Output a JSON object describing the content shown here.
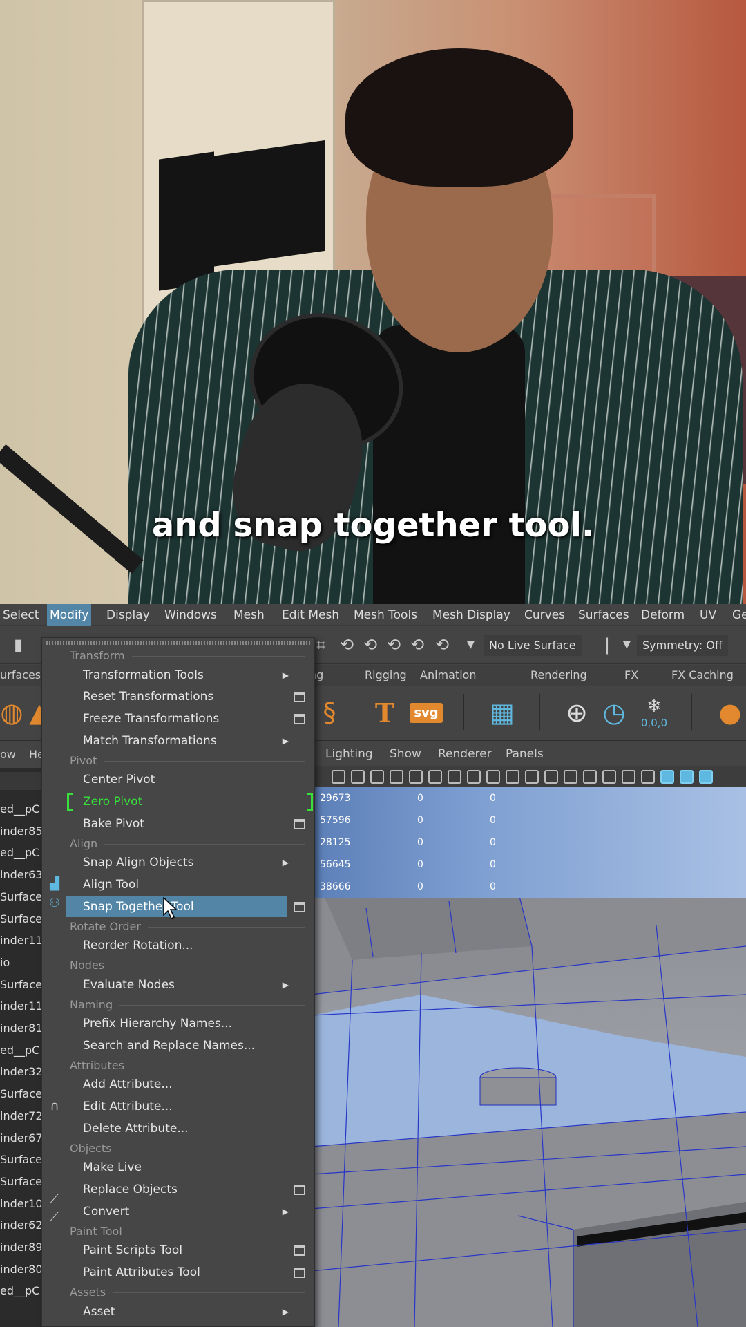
{
  "caption": "and snap together tool.",
  "menubar": [
    "Select",
    "Modify",
    "Display",
    "Windows",
    "Mesh",
    "Edit Mesh",
    "Mesh Tools",
    "Mesh Display",
    "Curves",
    "Surfaces",
    "Deform",
    "UV",
    "Ge"
  ],
  "menubar_active": "Modify",
  "statusline": {
    "live_surface": "No Live Surface",
    "symmetry": "Symmetry: Off"
  },
  "shelf_tabs": [
    "urfaces",
    "ng",
    "Rigging",
    "Animation",
    "Rendering",
    "FX",
    "FX Caching"
  ],
  "shelf_svg_label": "svg",
  "shelf_snap_label": "0,0,0",
  "outliner": {
    "header": [
      "ow",
      "He"
    ],
    "items": [
      "ed__pC",
      "inder85",
      "ed__pC",
      "inder63",
      "Surface",
      "Surface",
      "inder11",
      "io",
      "Surface",
      "inder11",
      "inder81",
      "ed__pC",
      "inder32",
      "Surface",
      "inder72",
      "inder67",
      "Surface",
      "Surface",
      "inder10",
      "inder62",
      "inder89",
      "inder80",
      "ed__pC"
    ]
  },
  "viewport": {
    "menu": [
      "Lighting",
      "Show",
      "Renderer",
      "Panels"
    ],
    "hud_rows": [
      [
        "29673",
        "0",
        "0"
      ],
      [
        "57596",
        "0",
        "0"
      ],
      [
        "28125",
        "0",
        "0"
      ],
      [
        "56645",
        "0",
        "0"
      ],
      [
        "38666",
        "0",
        "0"
      ]
    ]
  },
  "menu": {
    "sections": [
      {
        "label": "Transform",
        "items": [
          {
            "label": "Transformation Tools",
            "submenu": true
          },
          {
            "label": "Reset Transformations",
            "box": true
          },
          {
            "label": "Freeze Transformations",
            "box": true
          },
          {
            "label": "Match Transformations",
            "submenu": true
          }
        ]
      },
      {
        "label": "Pivot",
        "items": [
          {
            "label": "Center Pivot"
          },
          {
            "label": "Zero Pivot",
            "highlighted_green": true
          },
          {
            "label": "Bake Pivot",
            "box": true
          }
        ]
      },
      {
        "label": "Align",
        "items": [
          {
            "label": "Snap Align Objects",
            "submenu": true
          },
          {
            "label": "Align Tool"
          },
          {
            "label": "Snap Together Tool",
            "box": true,
            "hovered": true
          }
        ]
      },
      {
        "label": "Rotate Order",
        "items": [
          {
            "label": "Reorder Rotation..."
          }
        ]
      },
      {
        "label": "Nodes",
        "items": [
          {
            "label": "Evaluate Nodes",
            "submenu": true
          }
        ]
      },
      {
        "label": "Naming",
        "items": [
          {
            "label": "Prefix Hierarchy Names..."
          },
          {
            "label": "Search and Replace Names..."
          }
        ]
      },
      {
        "label": "Attributes",
        "items": [
          {
            "label": "Add Attribute..."
          },
          {
            "label": "Edit Attribute..."
          },
          {
            "label": "Delete Attribute..."
          }
        ]
      },
      {
        "label": "Objects",
        "items": [
          {
            "label": "Make Live"
          },
          {
            "label": "Replace Objects",
            "box": true
          },
          {
            "label": "Convert",
            "submenu": true
          }
        ]
      },
      {
        "label": "Paint Tool",
        "items": [
          {
            "label": "Paint Scripts Tool",
            "box": true
          },
          {
            "label": "Paint Attributes Tool",
            "box": true
          }
        ]
      },
      {
        "label": "Assets",
        "items": [
          {
            "label": "Asset",
            "submenu": true
          }
        ]
      }
    ]
  },
  "colors": {
    "highlight": "#5285a6",
    "green": "#37e03a",
    "menu_bg": "#464646"
  }
}
